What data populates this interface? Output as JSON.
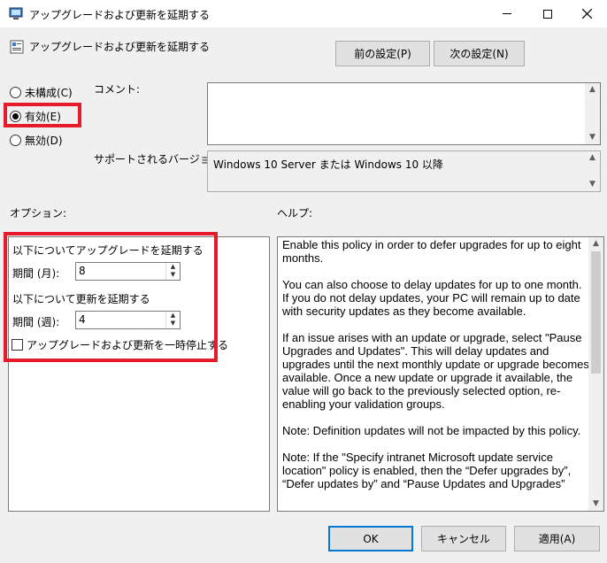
{
  "window": {
    "title": "アップグレードおよび更新を延期する"
  },
  "header": {
    "title": "アップグレードおよび更新を延期する",
    "prev_label": "前の設定(P)",
    "next_label": "次の設定(N)"
  },
  "state": {
    "options": [
      {
        "label": "未構成(C)",
        "checked": false
      },
      {
        "label": "有効(E)",
        "checked": true
      },
      {
        "label": "無効(D)",
        "checked": false
      }
    ]
  },
  "comment": {
    "label": "コメント:",
    "value": ""
  },
  "supported": {
    "label": "サポートされるバージョン:",
    "value": "Windows 10 Server または Windows 10 以降"
  },
  "sections": {
    "options_label": "オプション:",
    "help_label": "ヘルプ:"
  },
  "options": {
    "upgrade_heading": "以下についてアップグレードを延期する",
    "months_label": "期間 (月):",
    "months_value": "8",
    "update_heading": "以下について更新を延期する",
    "weeks_label": "期間 (週):",
    "weeks_value": "4",
    "pause_label": "アップグレードおよび更新を一時停止する",
    "pause_checked": false
  },
  "help": {
    "paragraphs": [
      "Enable this policy in order to defer upgrades for up to eight months.",
      "You can also choose to delay updates for up to one month. If you do not delay updates, your PC will remain up to date with security updates as they become available.",
      "If an issue arises with an update or upgrade, select \"Pause Upgrades and Updates\". This will delay updates and upgrades until the next monthly update or upgrade becomes available. Once a new update or upgrade it available, the value will go back to the previously selected option, re-enabling your validation groups.",
      "Note: Definition updates will not be impacted by this policy.",
      "Note: If the \"Specify intranet Microsoft update service location\" policy is enabled, then the “Defer upgrades by”, “Defer updates by” and “Pause Updates and Upgrades”"
    ]
  },
  "footer": {
    "ok_label": "OK",
    "cancel_label": "キャンセル",
    "apply_label": "適用(A)"
  },
  "colors": {
    "highlight": "#e51a2a",
    "default_button_border": "#0078d7"
  }
}
